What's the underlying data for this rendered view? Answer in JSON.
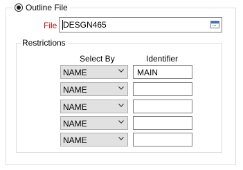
{
  "outline_file": {
    "option_label": "Outline File",
    "selected": true,
    "file_label": "File",
    "file_value": "DESGN465"
  },
  "restrictions": {
    "group_label": "Restrictions",
    "select_by_header": "Select By",
    "identifier_header": "Identifier",
    "rows": [
      {
        "select_by": "NAME",
        "identifier": "MAIN"
      },
      {
        "select_by": "NAME",
        "identifier": ""
      },
      {
        "select_by": "NAME",
        "identifier": ""
      },
      {
        "select_by": "NAME",
        "identifier": ""
      },
      {
        "select_by": "NAME",
        "identifier": ""
      }
    ]
  },
  "colors": {
    "required_label": "#b01717",
    "combo_background": "#e1e1e1",
    "group_border": "#dcdcdc"
  },
  "icons": {
    "radio": "radio-selected-icon",
    "browse": "browse-folder-icon",
    "dropdown": "chevron-down-icon"
  }
}
